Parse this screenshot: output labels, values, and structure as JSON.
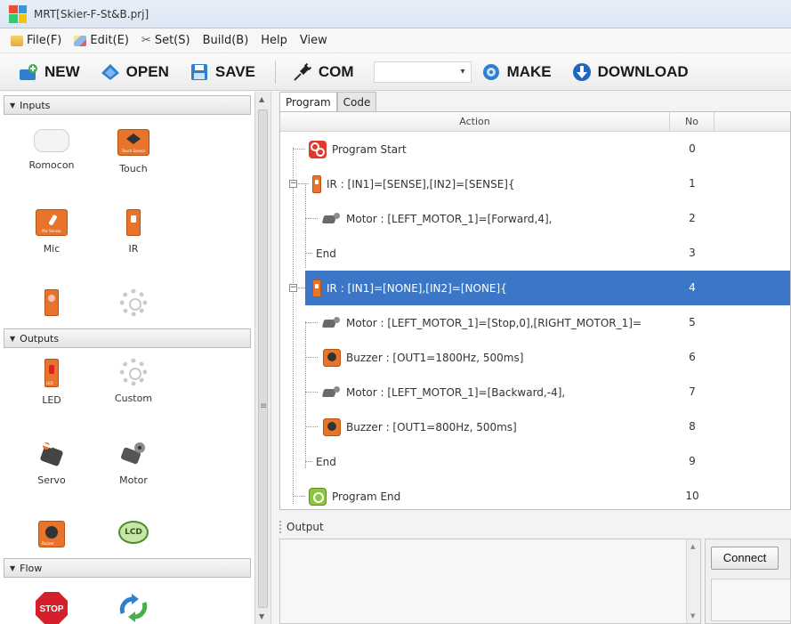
{
  "window": {
    "title": "MRT[Skier-F-St&B.prj]"
  },
  "menu": [
    {
      "label": "File(F)",
      "icon": "folder-icon"
    },
    {
      "label": "Edit(E)",
      "icon": "pencil-icon"
    },
    {
      "label": "Set(S)",
      "icon": "tools-icon"
    },
    {
      "label": "Build(B)"
    },
    {
      "label": "Help"
    },
    {
      "label": "View"
    }
  ],
  "toolbar": {
    "new_label": "NEW",
    "open_label": "OPEN",
    "save_label": "SAVE",
    "com_label": "COM",
    "com_value": "",
    "make_label": "MAKE",
    "download_label": "DOWNLOAD"
  },
  "palette": {
    "inputs_label": "Inputs",
    "outputs_label": "Outputs",
    "flow_label": "Flow",
    "inputs": [
      "Romocon",
      "Touch",
      "Mic",
      "IR"
    ],
    "outputs": [
      "LED",
      "Custom",
      "Servo",
      "Motor"
    ],
    "touch_icon_text": "Touch Sensor",
    "mic_icon_text": "Mic Sensor",
    "led_icon_text": "LED",
    "lcd_icon_text": "LCD",
    "buzzer_icon_text": "Buzzer",
    "stop_icon_text": "STOP"
  },
  "tabs": {
    "program": "Program",
    "code": "Code"
  },
  "grid": {
    "header_action": "Action",
    "header_no": "No",
    "rows": [
      {
        "text": "Program Start",
        "no": "0"
      },
      {
        "text": "IR : [IN1]=[SENSE],[IN2]=[SENSE]{",
        "no": "1"
      },
      {
        "text": "Motor : [LEFT_MOTOR_1]=[Forward,4],",
        "no": "2"
      },
      {
        "text": "End",
        "no": "3"
      },
      {
        "text": "IR : [IN1]=[NONE],[IN2]=[NONE]{",
        "no": "4"
      },
      {
        "text": "Motor : [LEFT_MOTOR_1]=[Stop,0],[RIGHT_MOTOR_1]=",
        "no": "5"
      },
      {
        "text": "Buzzer : [OUT1=1800Hz, 500ms]",
        "no": "6"
      },
      {
        "text": "Motor : [LEFT_MOTOR_1]=[Backward,-4],",
        "no": "7"
      },
      {
        "text": "Buzzer : [OUT1=800Hz, 500ms]",
        "no": "8"
      },
      {
        "text": "End",
        "no": "9"
      },
      {
        "text": "Program End",
        "no": "10"
      }
    ],
    "selected_row": 4
  },
  "output": {
    "label": "Output",
    "connect_label": "Connect"
  },
  "colors": {
    "selection": "#3c76c6",
    "accent_orange": "#e8742c",
    "start_red": "#e03a2c",
    "end_green": "#8cc63f"
  }
}
